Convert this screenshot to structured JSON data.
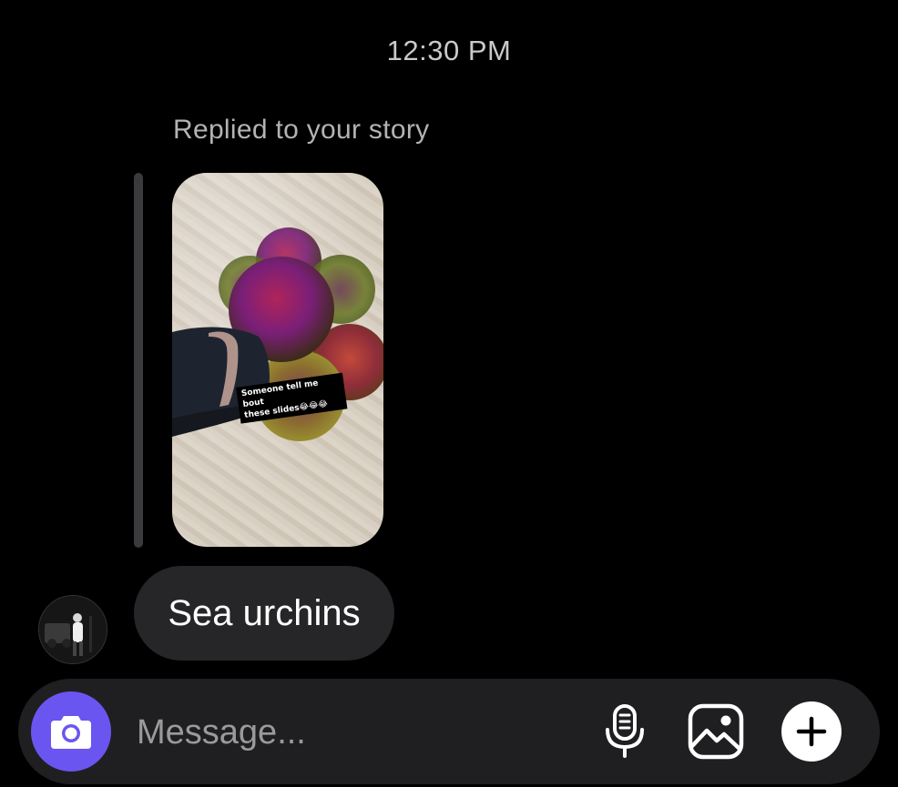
{
  "thread": {
    "timestamp": "12:30 PM",
    "reply_label": "Replied to your story",
    "story": {
      "caption": "Someone tell me bout\nthese slides😂😂😂"
    },
    "message": {
      "text": "Sea urchins"
    }
  },
  "composer": {
    "placeholder": "Message...",
    "icons": {
      "camera": "camera-icon",
      "mic": "microphone-icon",
      "gallery": "gallery-icon",
      "add": "plus-icon"
    },
    "accent": "#6b55f0"
  }
}
